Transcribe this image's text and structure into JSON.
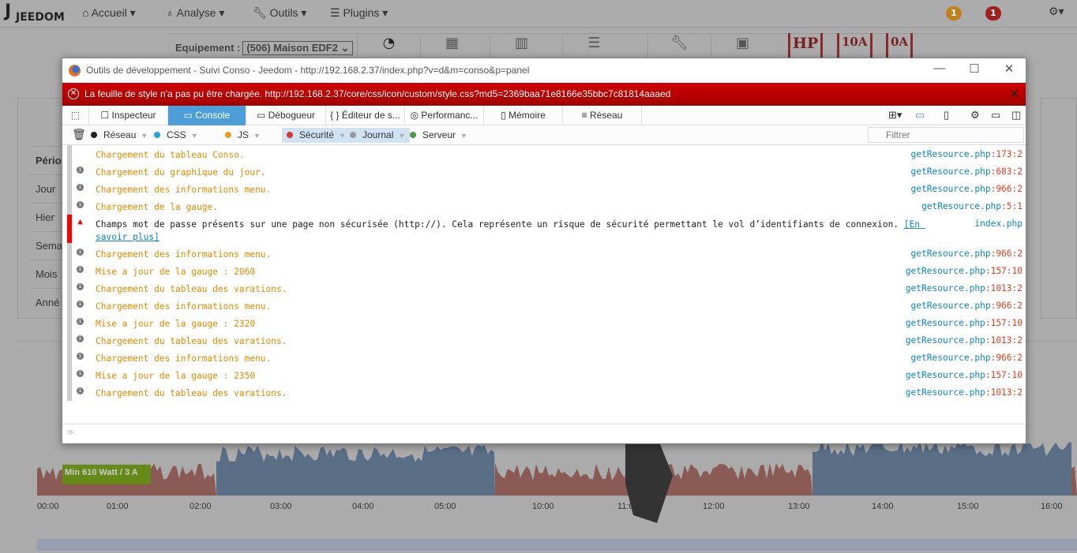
{
  "app": {
    "logo": "JEEDOM",
    "badges": [
      "1",
      "1"
    ],
    "badge_colors": [
      "#c08020",
      "#a02020"
    ]
  },
  "nav": {
    "items": [
      {
        "label": "Accueil",
        "icon": "home-icon"
      },
      {
        "label": "Analyse",
        "icon": "stethoscope-icon"
      },
      {
        "label": "Outils",
        "icon": "wrench-icon"
      },
      {
        "label": "Plugins",
        "icon": "list-icon"
      }
    ]
  },
  "toolbar": {
    "equip_label": "Equipement :",
    "equip_value": "(506) Maison EDF2",
    "tarifs": [
      "HP",
      "10A",
      "0A"
    ]
  },
  "periods": {
    "header": "Pério",
    "items": [
      "Jour",
      "Hier",
      "Sema",
      "Mois",
      "Anné"
    ]
  },
  "devtools": {
    "title": "Outils de développement - Suivi Conso - Jeedom - http://192.168.2.37/index.php?v=d&m=conso&p=panel",
    "error": "La feuille de style n'a pas pu être chargée. http://192.168.2.37/core/css/icon/custom/style.css?md5=2369baa71e8166e35bbc7c81814aaaed",
    "tabs": [
      "Inspecteur",
      "Console",
      "Débogueur",
      "Éditeur de s...",
      "Performanc...",
      "Mémoire",
      "Réseau"
    ],
    "active_tab": "Console",
    "filters": [
      {
        "label": "Réseau",
        "color": "#222",
        "on": false
      },
      {
        "label": "CSS",
        "color": "#1ea7e0",
        "on": false
      },
      {
        "label": "JS",
        "color": "#f09a20",
        "on": false
      },
      {
        "label": "Sécurité",
        "color": "#e03030",
        "on": true
      },
      {
        "label": "Journal",
        "color": "#999",
        "on": true
      },
      {
        "label": "Serveur",
        "color": "#4a9a4a",
        "on": false
      }
    ],
    "filter_placeholder": "Filtrer",
    "log": [
      {
        "msg": "Chargement du tableau Conso.",
        "file": "getResource.php",
        "line": ":173:2",
        "type": "info",
        "noicon": true
      },
      {
        "msg": "Chargement du graphique du jour.",
        "file": "getResource.php",
        "line": ":683:2",
        "type": "info"
      },
      {
        "msg": "Chargement des informations menu.",
        "file": "getResource.php",
        "line": ":966:2",
        "type": "info"
      },
      {
        "msg": "Chargement de la gauge.",
        "file": "getResource.php",
        "line": ":5:1",
        "type": "info"
      },
      {
        "msg": "Champs mot de passe présents sur une page non sécurisée (http://). Cela représente un risque de sécurité permettant le vol d’identifiants de connexion. ",
        "link": "[En savoir plus]",
        "file": "index.php",
        "line": "",
        "type": "warn"
      },
      {
        "msg": "Chargement des informations menu.",
        "file": "getResource.php",
        "line": ":966:2",
        "type": "info"
      },
      {
        "msg": "Mise a jour de la gauge : 2060",
        "file": "getResource.php",
        "line": ":157:10",
        "type": "info"
      },
      {
        "msg": "Chargement du tableau des varations.",
        "file": "getResource.php",
        "line": ":1013:2",
        "type": "info"
      },
      {
        "msg": "Chargement des informations menu.",
        "file": "getResource.php",
        "line": ":966:2",
        "type": "info"
      },
      {
        "msg": "Mise a jour de la gauge : 2320",
        "file": "getResource.php",
        "line": ":157:10",
        "type": "info"
      },
      {
        "msg": "Chargement du tableau des varations.",
        "file": "getResource.php",
        "line": ":1013:2",
        "type": "info"
      },
      {
        "msg": "Chargement des informations menu.",
        "file": "getResource.php",
        "line": ":966:2",
        "type": "info"
      },
      {
        "msg": "Mise a jour de la gauge : 2350",
        "file": "getResource.php",
        "line": ":157:10",
        "type": "info"
      },
      {
        "msg": "Chargement du tableau des varations.",
        "file": "getResource.php",
        "line": ":1013:2",
        "type": "info"
      }
    ]
  },
  "chart": {
    "min_label": "Min 610 Watt / 3 A",
    "ticks": [
      "00:00",
      "01:00",
      "02:00",
      "03:00",
      "04:00",
      "05:00",
      "10:00",
      "11:00",
      "12:00",
      "13:00",
      "14:00",
      "15:00",
      "16:00"
    ],
    "colors": {
      "hc": "#8a5a55",
      "hp": "#5a6e86"
    }
  }
}
